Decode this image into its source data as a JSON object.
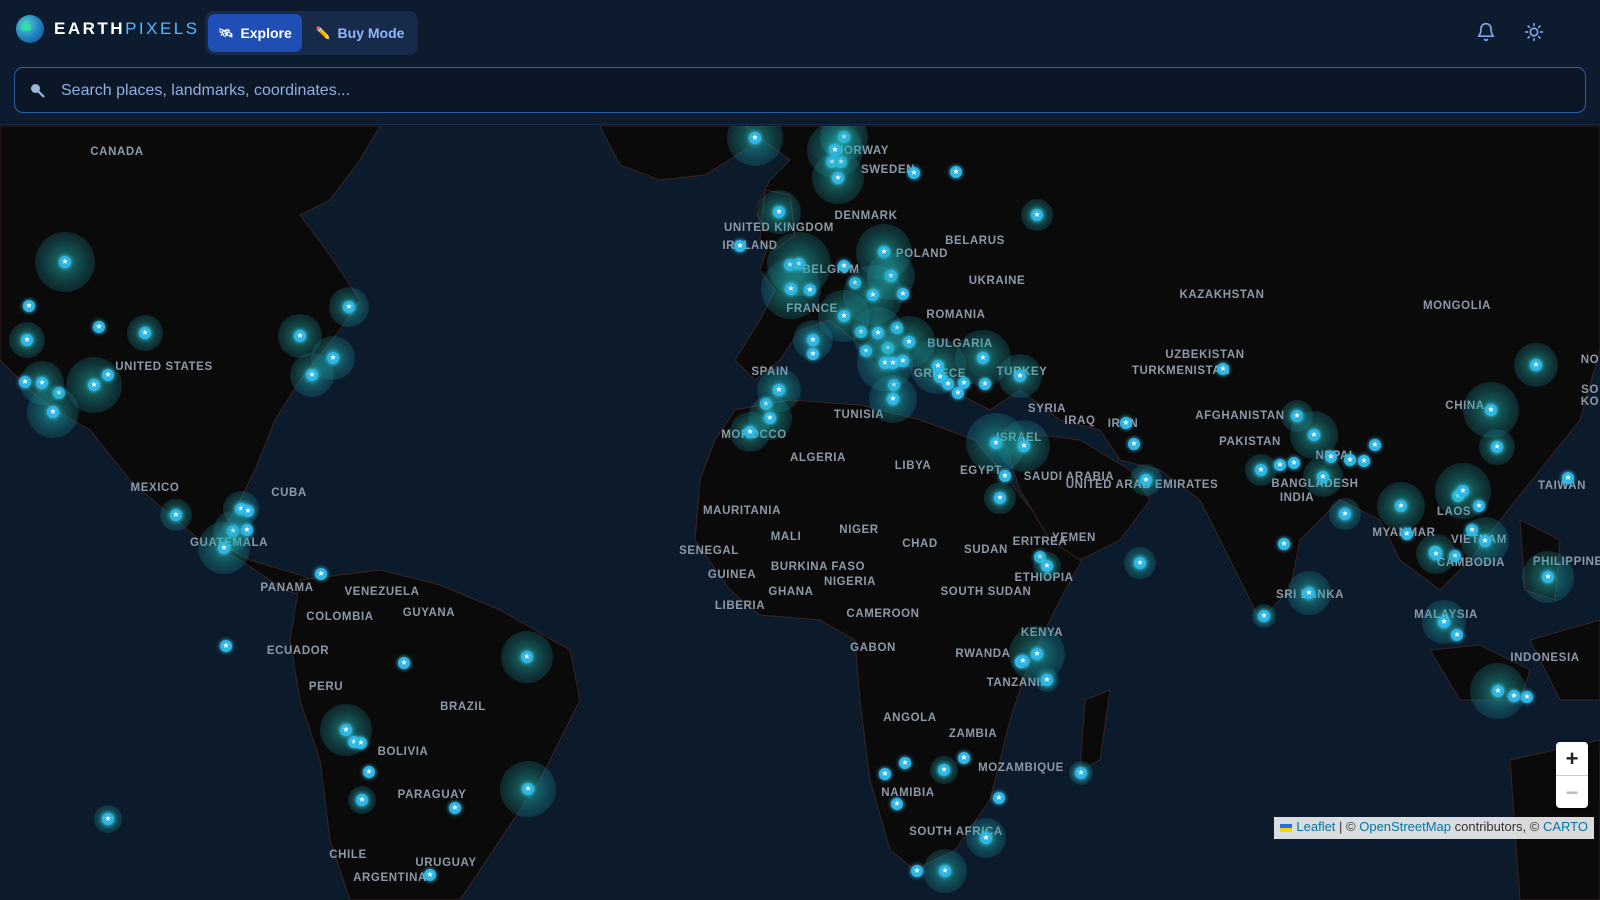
{
  "app": {
    "name_part1": "EARTH",
    "name_part2": "PIXELS"
  },
  "modes": {
    "explore": "Explore",
    "buy": "Buy Mode",
    "active": "Explore"
  },
  "search": {
    "placeholder": "Search places, landmarks, coordinates..."
  },
  "icons": {
    "logo": "globe-logo",
    "explore": "satellite-icon",
    "buy": "pencil-icon",
    "notifications": "bell-icon",
    "theme": "sun-icon",
    "search": "search-icon"
  },
  "colors": {
    "accent": "#1f4fb4",
    "marker": "#2eb6e6",
    "halo": "#24c8be",
    "background": "#0b1626"
  },
  "map": {
    "labels": [
      "CANADA",
      "NORWAY",
      "SWEDEN",
      "DENMARK",
      "UNITED KINGDOM",
      "IRELAND",
      "BELARUS",
      "POLAND",
      "BELGIUM",
      "UKRAINE",
      "KAZAKHSTAN",
      "MONGOLIA",
      "FRANCE",
      "ROMANIA",
      "BULGARIA",
      "UZBEKISTAN",
      "TURKMENISTAN",
      "UNITED STATES",
      "SPAIN",
      "TURKEY",
      "GREECE",
      "TUNISIA",
      "SYRIA",
      "IRAQ",
      "IRAN",
      "AFGHANISTAN",
      "CHINA",
      "MOROCCO",
      "ISRAEL",
      "PAKISTAN",
      "ALGERIA",
      "LIBYA",
      "EGYPT",
      "SAUDI ARABIA",
      "UNITED ARAB EMIRATES",
      "NEPAL",
      "BANGLADESH",
      "TAIWAN",
      "INDIA",
      "MEXICO",
      "CUBA",
      "MAURITANIA",
      "MALI",
      "NIGER",
      "CHAD",
      "SUDAN",
      "ERITREA",
      "YEMEN",
      "MYANMAR",
      "LAOS",
      "VIETNAM",
      "GUATEMALA",
      "SENEGAL",
      "BURKINA FASO",
      "GUINEA",
      "NIGERIA",
      "CAMBODIA",
      "PHILIPPINES",
      "ETHIOPIA",
      "GHANA",
      "SOUTH SUDAN",
      "PANAMA",
      "VENEZUELA",
      "SRI LANKA",
      "LIBERIA",
      "CAMEROON",
      "COLOMBIA",
      "GUYANA",
      "MALAYSIA",
      "KENYA",
      "ECUADOR",
      "GABON",
      "RWANDA",
      "INDONESIA",
      "TANZANIA",
      "PERU",
      "BRAZIL",
      "ANGOLA",
      "ZAMBIA",
      "BOLIVIA",
      "MOZAMBIQUE",
      "NAMIBIA",
      "PARAGUAY",
      "SOUTH AFRICA",
      "CHILE",
      "URUGUAY",
      "ARGENTINA",
      "NO",
      "SO",
      "KO"
    ],
    "markers_count": 130,
    "zoom_in": "+",
    "zoom_out": "−"
  },
  "attribution": {
    "leaflet": "Leaflet",
    "sep": " | © ",
    "osm": "OpenStreetMap",
    "contrib": " contributors, © ",
    "carto": "CARTO"
  }
}
